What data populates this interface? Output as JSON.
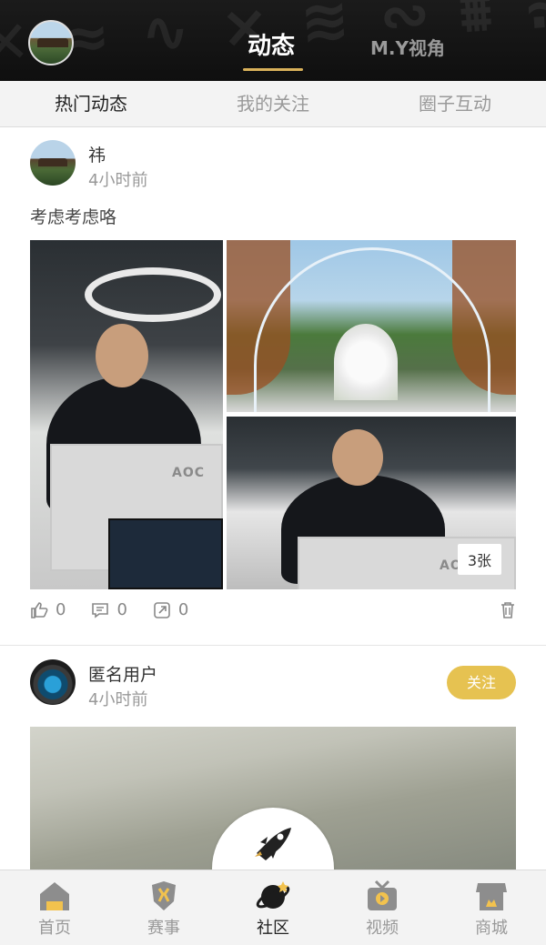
{
  "header": {
    "title_active": "动态",
    "title_inactive": "M.Y视角",
    "avatar": "user-avatar"
  },
  "subtabs": [
    {
      "label": "热门动态",
      "active": true
    },
    {
      "label": "我的关注",
      "active": false
    },
    {
      "label": "圈子互动",
      "active": false
    }
  ],
  "posts": [
    {
      "username": "祎",
      "time": "4小时前",
      "text": "考虑考虑咯",
      "image_count_label": "3张",
      "monitor_brand": "AOC",
      "likes": "0",
      "comments": "0",
      "shares": "0"
    },
    {
      "username": "匿名用户",
      "time": "4小时前",
      "follow_label": "关注"
    }
  ],
  "bottom_nav": [
    {
      "label": "首页",
      "icon": "home-icon",
      "active": false
    },
    {
      "label": "赛事",
      "icon": "match-icon",
      "active": false
    },
    {
      "label": "社区",
      "icon": "planet-icon",
      "active": true
    },
    {
      "label": "视频",
      "icon": "tv-icon",
      "active": false
    },
    {
      "label": "商城",
      "icon": "shop-icon",
      "active": false
    }
  ],
  "colors": {
    "accent_gold": "#d9b15a",
    "follow_button": "#e6c251",
    "header_bg": "#111111",
    "subtab_bg": "#f3f3f3"
  }
}
